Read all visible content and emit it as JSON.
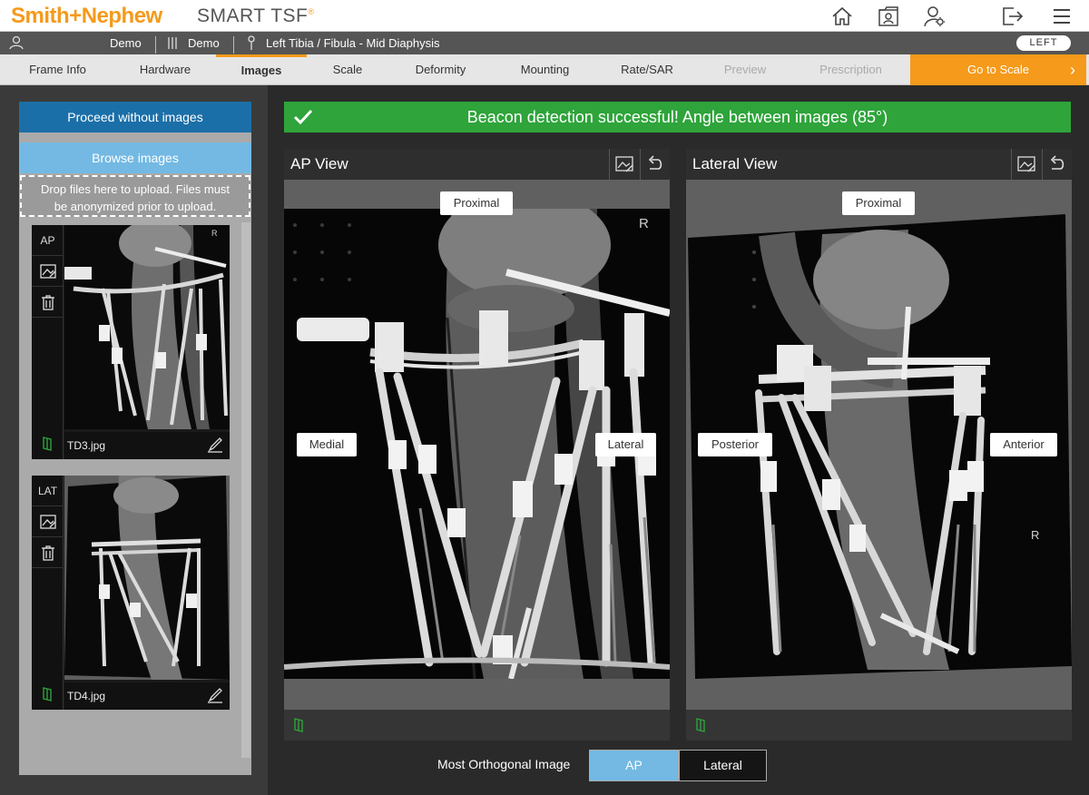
{
  "header": {
    "brand": "Smith+Nephew",
    "brand_left": "Smith",
    "brand_amp": "+",
    "brand_right": "Nephew",
    "product": "SMART TSF",
    "product_mark": "®",
    "icons": [
      "home-icon",
      "patient-folder-icon",
      "user-settings-icon",
      "logout-icon",
      "menu-icon"
    ]
  },
  "patient_bar": {
    "first_name": "Demo",
    "last_name": "Demo",
    "procedure": "Left Tibia / Fibula - Mid Diaphysis",
    "side": "LEFT"
  },
  "tabs": [
    {
      "label": "Frame Info",
      "state": "normal"
    },
    {
      "label": "Hardware",
      "state": "normal"
    },
    {
      "label": "Images",
      "state": "active"
    },
    {
      "label": "Scale",
      "state": "normal"
    },
    {
      "label": "Deformity",
      "state": "normal"
    },
    {
      "label": "Mounting",
      "state": "normal"
    },
    {
      "label": "Rate/SAR",
      "state": "normal"
    },
    {
      "label": "Preview",
      "state": "disabled"
    },
    {
      "label": "Prescription",
      "state": "disabled"
    }
  ],
  "go_to_scale": "Go to Scale",
  "left_panel": {
    "proceed_label": "Proceed without images",
    "browse_label": "Browse images",
    "drop_line1": "Drop files here to upload. Files must",
    "drop_line2": "be anonymized prior to upload.",
    "thumbnails": [
      {
        "view": "AP",
        "filename": "TD3.jpg"
      },
      {
        "view": "LAT",
        "filename": "TD4.jpg"
      }
    ]
  },
  "beacon_message": "Beacon detection successful! Angle between images (85°)",
  "views": {
    "ap": {
      "title": "AP View",
      "labels": {
        "proximal": "Proximal",
        "medial": "Medial",
        "lateral": "Lateral"
      },
      "marker": "R"
    },
    "lateral": {
      "title": "Lateral View",
      "labels": {
        "proximal": "Proximal",
        "posterior": "Posterior",
        "anterior": "Anterior"
      },
      "marker": "R"
    }
  },
  "orthogonal": {
    "label": "Most Orthogonal Image",
    "options": [
      "AP",
      "Lateral"
    ],
    "selected": "AP"
  },
  "colors": {
    "brand_orange": "#f59a1b",
    "success_green": "#2ea43a",
    "primary_blue": "#1b6fa8",
    "light_blue": "#73b9e3"
  }
}
